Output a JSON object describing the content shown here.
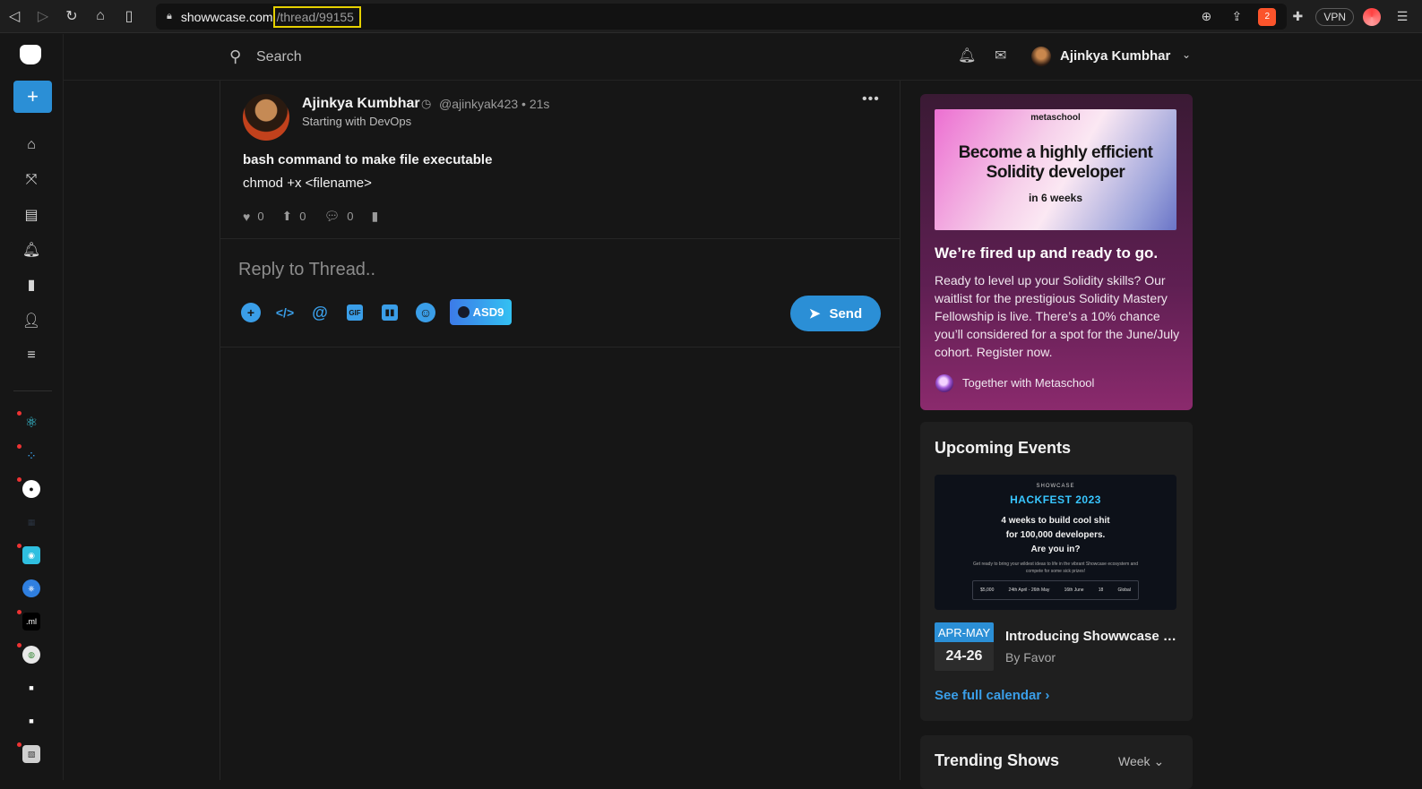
{
  "browser": {
    "url_host": "showwcase.com",
    "url_path": "/thread/99155",
    "vpn_label": "VPN",
    "brave_badge": "2"
  },
  "header": {
    "search_placeholder": "Search",
    "user_name": "Ajinkya Kumbhar"
  },
  "rail": {
    "add_label": "+",
    "community_ml_label": ".ml"
  },
  "post": {
    "author": "Ajinkya Kumbhar",
    "handle": "@ajinkyak423",
    "separator": "•",
    "time": "21s",
    "subtitle": "Starting with DevOps",
    "title": "bash command to make file executable",
    "body": "chmod +x <filename>",
    "likes": "0",
    "boosts": "0",
    "comments": "0"
  },
  "reply": {
    "placeholder": "Reply to Thread..",
    "asd9_label": "ASD9",
    "send_label": "Send"
  },
  "ad": {
    "brand": "metaschool",
    "headline_line1": "Become a highly efficient",
    "headline_line2": "Solidity developer",
    "duration": "in 6 weeks",
    "title": "We’re fired up and ready to go.",
    "text": "Ready to level up your Solidity skills? Our waitlist for the prestigious Solidity Mastery Fellowship is live. There’s a 10% chance you’ll considered for a spot for the June/July cohort. Register now.",
    "sponsor": "Together with Metaschool"
  },
  "events": {
    "title": "Upcoming Events",
    "banner_brand": "SHOWCASE",
    "banner_hackfest": "HACKFEST 2023",
    "banner_tag_line1": "4 weeks to build cool shit",
    "banner_tag_line2": "for 100,000 developers.",
    "banner_tag_line3": "Are you in?",
    "banner_small": "Get ready to bring your wildest ideas to life in the vibrant Showcase ecosystem and compete for some sick prizes!",
    "banner_row": [
      "$5,000",
      "24th April - 26th May",
      "16th June",
      "18",
      "Global"
    ],
    "month": "APR-MAY",
    "days": "24-26",
    "name": "Introducing Showwcase Hackfest",
    "by": "By Favor",
    "see_calendar": "See full calendar"
  },
  "trending": {
    "title": "Trending Shows",
    "period": "Week"
  }
}
